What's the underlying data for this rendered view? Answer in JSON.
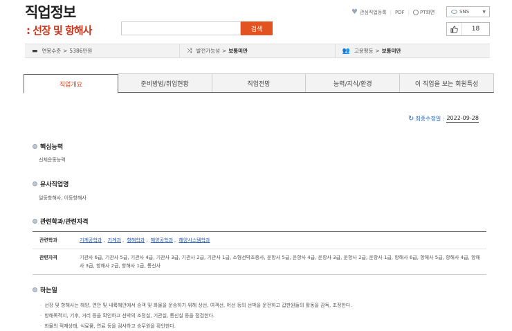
{
  "header": {
    "title": "직업정보",
    "subtitle": ": 선장 및 항해사",
    "search_placeholder": "",
    "search_button": "검색"
  },
  "toplinks": {
    "bookmark": "관심직업등록",
    "pdf": "PDF",
    "pt": "PT화면",
    "sns": "SNS"
  },
  "like": {
    "count": "18"
  },
  "infobar": {
    "salary_label": "연봉수준",
    "salary_value": "5386만원",
    "growth_label": "발전가능성",
    "growth_value": "보통미만",
    "equality_label": "고용평등",
    "equality_value": "보통미만"
  },
  "tabs": [
    {
      "label": "직업개요",
      "active": true
    },
    {
      "label": "준비방법/취업현황",
      "active": false
    },
    {
      "label": "직업전망",
      "active": false
    },
    {
      "label": "능력/지식/환경",
      "active": false
    },
    {
      "label": "이 직업을 보는 회원특성",
      "active": false
    }
  ],
  "updated": {
    "label": "최종수정일 :",
    "date": "2022-09-28"
  },
  "core": {
    "heading": "핵심능력",
    "text": "신체운동능력"
  },
  "similar": {
    "heading": "유사직업명",
    "text": "일등항해사, 이등항해사"
  },
  "related": {
    "heading": "관련학과/관련자격",
    "dept_label": "관련학과",
    "depts": [
      "기계공학과",
      "기계과",
      "항해학과",
      "해양공학과",
      "해양시스템학과"
    ],
    "cert_label": "관련자격",
    "certs": "기관사 6급, 기관사 5급, 기관사 4급, 기관사 3급, 기관사 2급, 기관사 1급, 소형선박조종사, 운항사 5급, 운항사 4급, 운항사 3급, 운항사 2급, 운항사 1급, 항해사 6급, 항해사 5급, 항해사 4급, 항해사 3급, 항해사 2급, 항해사 1급, 통신사"
  },
  "duties": {
    "heading": "하는일",
    "items": [
      "선장 및 항해사는 해양, 연안 및 내륙해안에서 승객 및 화물을 운송하기 위해 상선, 여객선, 어선 등의 선박을 운전하고 갑판원들의 활동을 감독, 조정한다.",
      "항해목적지, 기후, 거리 등을 확인하고 선박의 조정실, 기관실, 통신실 등을 점검한다.",
      "화물의 적재상태, 식료품, 연료 등을 검사하고 승무원을 확인한다."
    ]
  }
}
